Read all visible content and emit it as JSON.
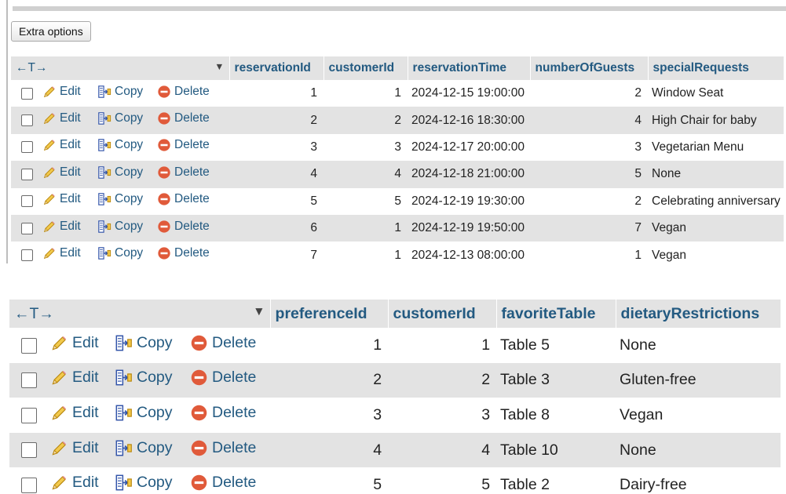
{
  "toolbar": {
    "extra_options_label": "Extra options"
  },
  "nav": {
    "arrows_label": "←T→",
    "sort_caret": "▼"
  },
  "actions": {
    "edit": "Edit",
    "copy": "Copy",
    "delete": "Delete"
  },
  "colors": {
    "link": "#235a81",
    "header_bg": "#e3e3e3",
    "delete_icon": "#e05a3a"
  },
  "reservations": {
    "columns": [
      "reservationId",
      "customerId",
      "reservationTime",
      "numberOfGuests",
      "specialRequests"
    ],
    "rows": [
      [
        "1",
        "1",
        "2024-12-15 19:00:00",
        "2",
        "Window Seat"
      ],
      [
        "2",
        "2",
        "2024-12-16 18:30:00",
        "4",
        "High Chair for baby"
      ],
      [
        "3",
        "3",
        "2024-12-17 20:00:00",
        "3",
        "Vegetarian Menu"
      ],
      [
        "4",
        "4",
        "2024-12-18 21:00:00",
        "5",
        "None"
      ],
      [
        "5",
        "5",
        "2024-12-19 19:30:00",
        "2",
        "Celebrating anniversary"
      ],
      [
        "6",
        "1",
        "2024-12-19 19:50:00",
        "7",
        "Vegan"
      ],
      [
        "7",
        "1",
        "2024-12-13 08:00:00",
        "1",
        "Vegan"
      ]
    ]
  },
  "preferences": {
    "columns": [
      "preferenceId",
      "customerId",
      "favoriteTable",
      "dietaryRestrictions"
    ],
    "rows": [
      [
        "1",
        "1",
        "Table 5",
        "None"
      ],
      [
        "2",
        "2",
        "Table 3",
        "Gluten-free"
      ],
      [
        "3",
        "3",
        "Table 8",
        "Vegan"
      ],
      [
        "4",
        "4",
        "Table 10",
        "None"
      ],
      [
        "5",
        "5",
        "Table 2",
        "Dairy-free"
      ]
    ]
  },
  "icons": {
    "edit": "pencil-icon",
    "copy": "copy-icon",
    "delete": "delete-icon"
  }
}
